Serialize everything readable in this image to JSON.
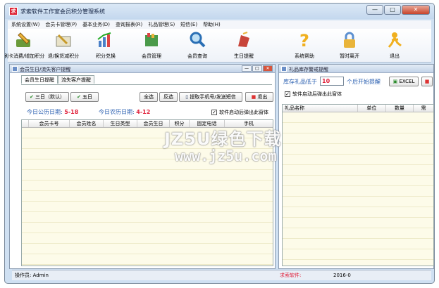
{
  "window": {
    "title": "求索软件工作室会员积分管理系统"
  },
  "menu": [
    "系统设置(W)",
    "会员卡管理(P)",
    "基本业务(D)",
    "查询报表(R)",
    "礼品管理(S)",
    "短信(E)",
    "帮助(H)"
  ],
  "toolbar": [
    {
      "label": "刷卡消费/增加积分",
      "icon": "pen-card-icon"
    },
    {
      "label": "退/换货减积分",
      "icon": "return-icon"
    },
    {
      "label": "积分兑换",
      "icon": "exchange-chart-icon"
    },
    {
      "label": "会员管理",
      "icon": "members-icon"
    },
    {
      "label": "会员查询",
      "icon": "magnifier-icon"
    },
    {
      "label": "生日提醒",
      "icon": "birthday-icon"
    },
    {
      "label": "系统帮助",
      "icon": "question-icon"
    },
    {
      "label": "暂时离开",
      "icon": "lock-icon"
    },
    {
      "label": "退出",
      "icon": "exit-person-icon"
    }
  ],
  "left_pane": {
    "title": "会员生日/流失客户提醒",
    "tabs": [
      "会员生日提醒",
      "流失客户提醒"
    ],
    "btn_3days": "三日（默认）",
    "btn_5days": "五日",
    "btn_select_all": "全选",
    "btn_invert": "反选",
    "btn_sms": "提取手机号/发送短信",
    "btn_exit": "退出",
    "solar_label": "今日公历日期:",
    "solar_value": "5-18",
    "lunar_label": "今日农历日期:",
    "lunar_value": "4-12",
    "checkbox_label": "软件启动后弹出此窗体",
    "columns": [
      "会员卡号",
      "会员姓名",
      "生日类型",
      "会员生日",
      "积分",
      "固定电话",
      "手机"
    ]
  },
  "right_pane": {
    "title": "礼品库存警戒提醒",
    "stock_label": "库存礼品低于",
    "stock_value": "10",
    "stock_suffix": "个后开始提醒",
    "btn_excel": "EXCEL",
    "checkbox_label": "软件启动后弹出此窗体",
    "columns": [
      "礼品名称",
      "单位",
      "数量",
      "需"
    ]
  },
  "status": {
    "operator": "操作员: Admin",
    "software": "求索软件:",
    "date": "2016-0"
  },
  "watermark": {
    "line1": "JZ5U绿色下载",
    "line2": "www.jz5u.com"
  },
  "colors": {
    "accent": "#2a5fb0",
    "highlight": "#e0203a",
    "grid_bg": "#fdfbe9"
  }
}
